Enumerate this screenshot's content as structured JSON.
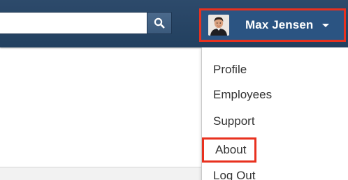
{
  "header": {
    "search": {
      "value": "",
      "placeholder": "",
      "icon": "search-icon"
    },
    "user_menu": {
      "name": "Max Jensen",
      "avatar_icon": "user-avatar",
      "caret_icon": "caret-down-icon"
    }
  },
  "dropdown": {
    "items": [
      {
        "label": "Profile"
      },
      {
        "label": "Employees"
      },
      {
        "label": "Support"
      },
      {
        "label": "About"
      },
      {
        "label": "Log Out"
      }
    ]
  },
  "colors": {
    "header_bg": "#22405f",
    "user_menu_bg": "#2b5482",
    "highlight": "#e8311f",
    "menu_text": "#333333"
  }
}
